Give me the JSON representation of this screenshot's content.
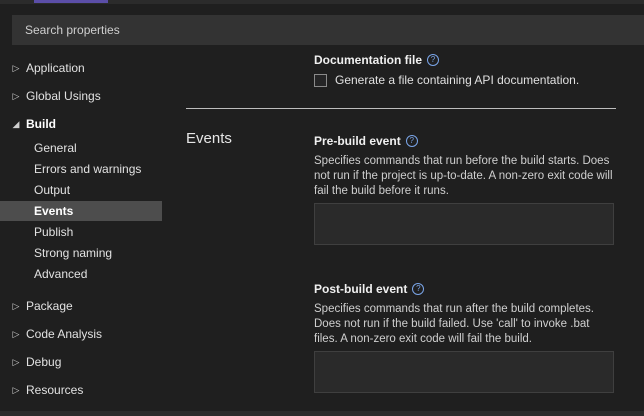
{
  "search": {
    "placeholder": "Search properties"
  },
  "sidebar": {
    "items": [
      {
        "label": "Application",
        "chevron": "▷"
      },
      {
        "label": "Global Usings",
        "chevron": "▷"
      },
      {
        "label": "Build",
        "chevron": "◢"
      },
      {
        "label": "General"
      },
      {
        "label": "Errors and warnings"
      },
      {
        "label": "Output"
      },
      {
        "label": "Events"
      },
      {
        "label": "Publish"
      },
      {
        "label": "Strong naming"
      },
      {
        "label": "Advanced"
      },
      {
        "label": "Package",
        "chevron": "▷"
      },
      {
        "label": "Code Analysis",
        "chevron": "▷"
      },
      {
        "label": "Debug",
        "chevron": "▷"
      },
      {
        "label": "Resources",
        "chevron": "▷"
      }
    ]
  },
  "documentation": {
    "title": "Documentation file",
    "help": "?",
    "checkbox_label": "Generate a file containing API documentation."
  },
  "events_section": {
    "title": "Events"
  },
  "pre_build": {
    "title": "Pre-build event",
    "help": "?",
    "description": "Specifies commands that run before the build starts. Does not run if the project is up-to-date. A non-zero exit code will fail the build before it runs."
  },
  "post_build": {
    "title": "Post-build event",
    "help": "?",
    "description": "Specifies commands that run after the build completes. Does not run if the build failed. Use 'call' to invoke .bat files. A non-zero exit code will fail the build."
  }
}
